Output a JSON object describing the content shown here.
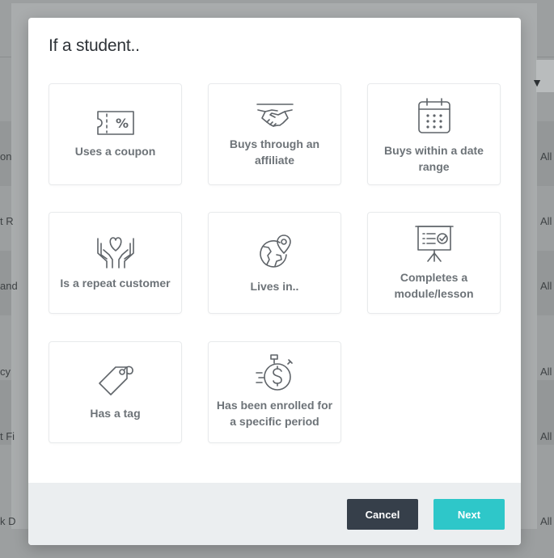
{
  "background": {
    "row_fragments": [
      "on",
      "t R",
      "and",
      "cy",
      "t Fi",
      "k D"
    ],
    "right_fragments": [
      "All",
      "All",
      "All",
      "All",
      "All",
      "All"
    ]
  },
  "modal": {
    "title": "If a student..",
    "options": [
      {
        "label": "Uses a coupon",
        "icon": "coupon-icon"
      },
      {
        "label": "Buys through an affiliate",
        "icon": "handshake-icon"
      },
      {
        "label": "Buys within a date range",
        "icon": "calendar-icon"
      },
      {
        "label": "Is a repeat customer",
        "icon": "heart-hands-icon"
      },
      {
        "label": "Lives in..",
        "icon": "globe-location-icon"
      },
      {
        "label": "Completes a module/lesson",
        "icon": "presentation-board-icon"
      },
      {
        "label": "Has a tag",
        "icon": "tag-icon"
      },
      {
        "label": "Has been enrolled for a specific period",
        "icon": "stopwatch-dollar-icon"
      }
    ],
    "footer": {
      "cancel_label": "Cancel",
      "next_label": "Next"
    }
  },
  "colors": {
    "accent": "#2ec7c9",
    "dark_button": "#363f4a",
    "card_text": "#6d7378",
    "icon_stroke": "#5f6469"
  }
}
